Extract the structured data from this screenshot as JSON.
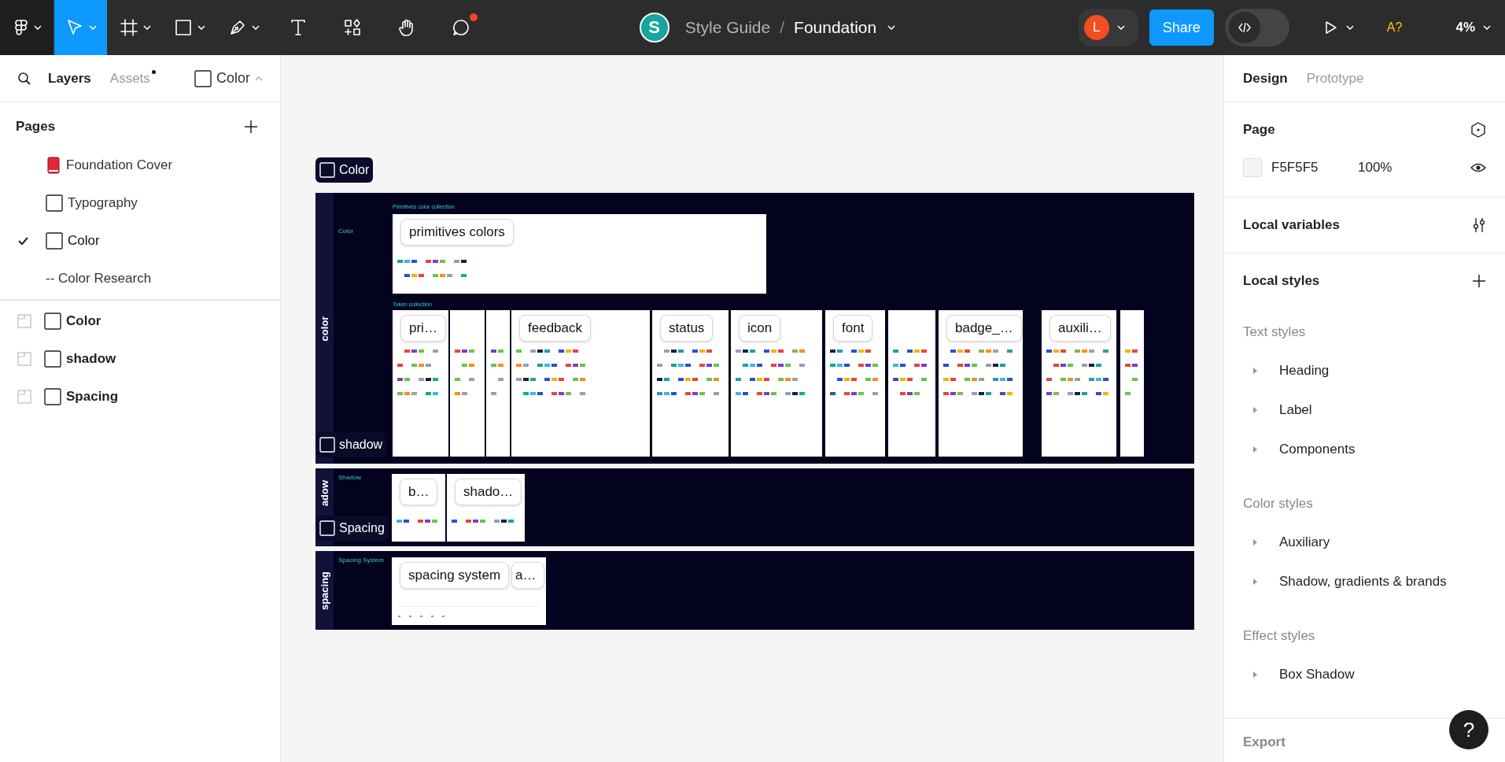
{
  "toolbar": {
    "tools": [
      {
        "kind": "move",
        "selected": true,
        "caret": true,
        "notification": false
      },
      {
        "kind": "frame",
        "selected": false,
        "caret": true,
        "notification": false
      },
      {
        "kind": "shape",
        "selected": false,
        "caret": true,
        "notification": false
      },
      {
        "kind": "pen",
        "selected": false,
        "caret": true,
        "notification": false
      },
      {
        "kind": "text",
        "selected": false,
        "caret": false,
        "notification": false
      },
      {
        "kind": "resources",
        "selected": false,
        "caret": false,
        "notification": false
      },
      {
        "kind": "hand",
        "selected": false,
        "caret": false,
        "notification": false
      },
      {
        "kind": "comment",
        "selected": false,
        "caret": false,
        "notification": true
      }
    ],
    "team_initial": "S",
    "project": "Style Guide",
    "separator": "/",
    "file": "Foundation",
    "user_initial": "L",
    "share": "Share",
    "dev_mode": {
      "on": false
    },
    "ai_label": "A?",
    "zoom": "4%"
  },
  "left_panel": {
    "tabs": [
      {
        "label": "Layers",
        "selected": true,
        "unread": false
      },
      {
        "label": "Assets",
        "selected": false,
        "unread": true
      }
    ],
    "page_menu": "Color",
    "pages_title": "Pages",
    "pages": [
      {
        "label": "Foundation Cover",
        "kind": "book",
        "selected": false
      },
      {
        "label": "Typography",
        "kind": "frame",
        "selected": false
      },
      {
        "label": "Color",
        "kind": "frame",
        "selected": true
      },
      {
        "label": "-- Color Research",
        "kind": "plain",
        "selected": false
      }
    ],
    "layers": [
      {
        "label": "Color"
      },
      {
        "label": "shadow"
      },
      {
        "label": "Spacing"
      }
    ]
  },
  "canvas": {
    "sections": [
      {
        "tag": "Color",
        "side_label": "color",
        "caption": "Color",
        "collections": [
          {
            "title": "Primitives color collection",
            "cards": [
              {
                "kind": "labeled",
                "label": "primitives colors"
              }
            ]
          },
          {
            "title": "Token collection",
            "cards": [
              {
                "kind": "labeled",
                "label": "pri…"
              },
              {
                "kind": "plain"
              },
              {
                "kind": "plain"
              },
              {
                "kind": "labeled",
                "label": "feedback"
              },
              {
                "kind": "labeled",
                "label": "status"
              },
              {
                "kind": "labeled",
                "label": "icon"
              },
              {
                "kind": "labeled",
                "label": "font"
              },
              {
                "kind": "plain"
              },
              {
                "kind": "labeled",
                "label": "badge_…"
              },
              {
                "kind": "labeled",
                "label": "auxili…"
              },
              {
                "kind": "plain"
              }
            ]
          }
        ]
      },
      {
        "tag": "shadow",
        "side_label": "adow",
        "caption": "Shadow",
        "collections": [
          {
            "cards": [
              {
                "kind": "labeled",
                "label": "b…"
              },
              {
                "kind": "labeled",
                "label": "shado…"
              }
            ]
          }
        ]
      },
      {
        "tag": "Spacing",
        "side_label": "spacing",
        "caption": "Spacing System",
        "collections": [
          {
            "cards": [
              {
                "kind": "labeled",
                "label": "spacing system"
              },
              {
                "kind": "labeled",
                "label": "a…"
              }
            ]
          }
        ]
      }
    ]
  },
  "right_panel": {
    "tabs": [
      {
        "label": "Design",
        "selected": true
      },
      {
        "label": "Prototype",
        "selected": false
      }
    ],
    "page": {
      "title": "Page",
      "fill": "F5F5F5",
      "opacity": "100%"
    },
    "local_variables": "Local variables",
    "local_styles": {
      "title": "Local styles",
      "groups": [
        {
          "title": "Text styles",
          "items": [
            {
              "label": "Heading",
              "expanded": false
            },
            {
              "label": "Label",
              "expanded": false
            },
            {
              "label": "Components",
              "expanded": false
            }
          ]
        },
        {
          "title": "Color styles",
          "items": [
            {
              "label": "Auxiliary",
              "expanded": false
            },
            {
              "label": "Shadow, gradients & brands",
              "expanded": false
            }
          ]
        },
        {
          "title": "Effect styles",
          "items": [
            {
              "label": "Box Shadow",
              "expanded": false
            }
          ]
        }
      ]
    },
    "export": "Export"
  },
  "help": "?"
}
